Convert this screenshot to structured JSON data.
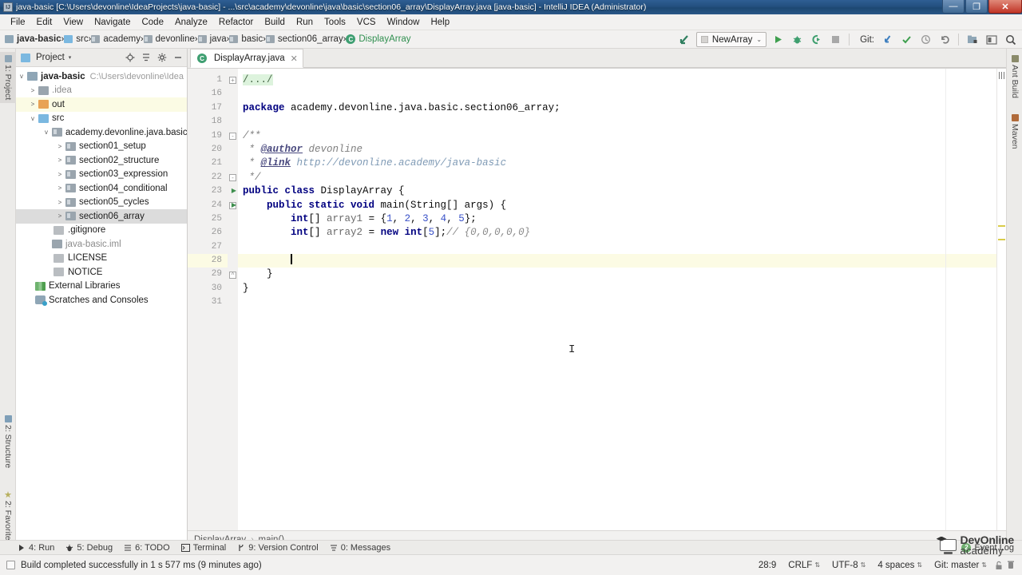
{
  "window": {
    "title": "java-basic [C:\\Users\\devonline\\IdeaProjects\\java-basic] - ...\\src\\academy\\devonline\\java\\basic\\section06_array\\DisplayArray.java [java-basic] - IntelliJ IDEA (Administrator)",
    "icon": "intellij-idea-icon",
    "minimize": "—",
    "maximize": "❐",
    "close": "✕"
  },
  "menubar": {
    "items": [
      {
        "label": "File"
      },
      {
        "label": "Edit"
      },
      {
        "label": "View"
      },
      {
        "label": "Navigate"
      },
      {
        "label": "Code"
      },
      {
        "label": "Analyze"
      },
      {
        "label": "Refactor"
      },
      {
        "label": "Build"
      },
      {
        "label": "Run"
      },
      {
        "label": "Tools"
      },
      {
        "label": "VCS"
      },
      {
        "label": "Window"
      },
      {
        "label": "Help"
      }
    ]
  },
  "navbar": {
    "breadcrumbs": [
      {
        "label": "java-basic",
        "icon": "project-icon"
      },
      {
        "label": "src",
        "icon": "source-folder-icon"
      },
      {
        "label": "academy",
        "icon": "package-icon"
      },
      {
        "label": "devonline",
        "icon": "package-icon"
      },
      {
        "label": "java",
        "icon": "package-icon"
      },
      {
        "label": "basic",
        "icon": "package-icon"
      },
      {
        "label": "section06_array",
        "icon": "package-icon"
      },
      {
        "label": "DisplayArray",
        "icon": "java-class-icon"
      }
    ],
    "separator": "›",
    "run_config": {
      "name": "NewArray",
      "chevron": "⌄"
    },
    "git_label": "Git:",
    "tool_icons": [
      "back-arrow-icon",
      "run-icon",
      "debug-icon",
      "run-with-coverage-icon",
      "stop-icon",
      "git-update-icon",
      "git-commit-icon",
      "history-icon",
      "revert-icon",
      "settings-project-icon",
      "restore-layout-icon",
      "search-everywhere-icon"
    ]
  },
  "left_strip": {
    "tabs": [
      {
        "label": "1: Project",
        "icon": "project-tool-icon",
        "selected": true
      },
      {
        "label": "2: Structure",
        "icon": "structure-tool-icon",
        "selected": false
      },
      {
        "label": "2: Favorites",
        "icon": "favorites-star-icon",
        "selected": false
      }
    ]
  },
  "right_strip": {
    "tabs": [
      {
        "label": "Ant Build",
        "icon": "ant-build-icon"
      },
      {
        "label": "Maven",
        "icon": "maven-icon"
      }
    ]
  },
  "project_panel": {
    "title": "Project",
    "chevron": "▾",
    "header_icons": [
      "locate-icon",
      "collapse-all-icon",
      "settings-gear-icon",
      "hide-icon"
    ],
    "tree": [
      {
        "label": "java-basic",
        "path": "C:\\Users\\devonline\\IdeaProjects",
        "indent": 0,
        "twisty": "v",
        "icon": "project-icon",
        "bold": true,
        "state": "normal"
      },
      {
        "label": ".idea",
        "indent": 1,
        "twisty": ">",
        "icon": "folder-gray-icon",
        "dim": true,
        "state": "normal"
      },
      {
        "label": "out",
        "indent": 1,
        "twisty": ">",
        "icon": "folder-orange-icon",
        "state": "highlight"
      },
      {
        "label": "src",
        "indent": 1,
        "twisty": "v",
        "icon": "folder-blue-icon",
        "state": "normal"
      },
      {
        "label": "academy.devonline.java.basic",
        "indent": 2,
        "twisty": "v",
        "icon": "package-icon",
        "state": "normal"
      },
      {
        "label": "section01_setup",
        "indent": 3,
        "twisty": ">",
        "icon": "package-icon",
        "state": "normal"
      },
      {
        "label": "section02_structure",
        "indent": 3,
        "twisty": ">",
        "icon": "package-icon",
        "state": "normal"
      },
      {
        "label": "section03_expression",
        "indent": 3,
        "twisty": ">",
        "icon": "package-icon",
        "state": "normal"
      },
      {
        "label": "section04_conditional",
        "indent": 3,
        "twisty": ">",
        "icon": "package-icon",
        "state": "normal"
      },
      {
        "label": "section05_cycles",
        "indent": 3,
        "twisty": ">",
        "icon": "package-icon",
        "state": "normal"
      },
      {
        "label": "section06_array",
        "indent": 3,
        "twisty": ">",
        "icon": "package-icon",
        "state": "selected"
      },
      {
        "label": ".gitignore",
        "indent": 2,
        "twisty": "",
        "icon": "file-icon",
        "state": "normal"
      },
      {
        "label": "java-basic.iml",
        "indent": 2,
        "twisty": "",
        "icon": "iml-file-icon",
        "dim": true,
        "state": "normal"
      },
      {
        "label": "LICENSE",
        "indent": 2,
        "twisty": "",
        "icon": "file-icon",
        "state": "normal"
      },
      {
        "label": "NOTICE",
        "indent": 2,
        "twisty": "",
        "icon": "file-icon",
        "state": "normal"
      },
      {
        "label": "External Libraries",
        "indent": 0,
        "twisty": "",
        "icon": "library-icon",
        "state": "normal"
      },
      {
        "label": "Scratches and Consoles",
        "indent": 0,
        "twisty": "",
        "icon": "scratches-icon",
        "state": "normal"
      }
    ]
  },
  "editor": {
    "tab": {
      "label": "DisplayArray.java",
      "icon": "java-class-icon",
      "close": "✕"
    },
    "lines": [
      {
        "num": "1",
        "fold": "+",
        "gmark": "",
        "current": false,
        "tokens": [
          {
            "t": "/.../",
            "c": "fold"
          }
        ]
      },
      {
        "num": "16",
        "fold": "",
        "gmark": "",
        "current": false,
        "tokens": []
      },
      {
        "num": "17",
        "fold": "",
        "gmark": "",
        "current": false,
        "tokens": [
          {
            "t": "package",
            "c": "kw"
          },
          {
            "t": " academy.devonline.java.basic.section06_array;",
            "c": "plain"
          }
        ]
      },
      {
        "num": "18",
        "fold": "",
        "gmark": "",
        "current": false,
        "tokens": []
      },
      {
        "num": "19",
        "fold": "-",
        "gmark": "",
        "current": false,
        "tokens": [
          {
            "t": "/**",
            "c": "jdoc"
          }
        ]
      },
      {
        "num": "20",
        "fold": "",
        "gmark": "",
        "current": false,
        "tokens": [
          {
            "t": " * ",
            "c": "jdoc"
          },
          {
            "t": "@author",
            "c": "jtag"
          },
          {
            "t": " devonline",
            "c": "jdoc"
          }
        ]
      },
      {
        "num": "21",
        "fold": "",
        "gmark": "",
        "current": false,
        "tokens": [
          {
            "t": " * ",
            "c": "jdoc"
          },
          {
            "t": "@link",
            "c": "jtag"
          },
          {
            "t": " http://devonline.academy/java-basic",
            "c": "link"
          }
        ]
      },
      {
        "num": "22",
        "fold": "-",
        "gmark": "",
        "current": false,
        "tokens": [
          {
            "t": " */",
            "c": "jdoc"
          }
        ]
      },
      {
        "num": "23",
        "fold": "",
        "gmark": "▶",
        "current": false,
        "tokens": [
          {
            "t": "public class",
            "c": "kw"
          },
          {
            "t": " DisplayArray {",
            "c": "plain"
          }
        ]
      },
      {
        "num": "24",
        "fold": "-",
        "gmark": "▶",
        "current": false,
        "tokens": [
          {
            "t": "    ",
            "c": "plain"
          },
          {
            "t": "public static void",
            "c": "kw"
          },
          {
            "t": " main(String[] args) {",
            "c": "plain"
          }
        ]
      },
      {
        "num": "25",
        "fold": "",
        "gmark": "",
        "current": false,
        "tokens": [
          {
            "t": "        ",
            "c": "plain"
          },
          {
            "t": "int",
            "c": "kw"
          },
          {
            "t": "[] ",
            "c": "plain"
          },
          {
            "t": "array1",
            "c": "ident"
          },
          {
            "t": " = {",
            "c": "plain"
          },
          {
            "t": "1",
            "c": "num"
          },
          {
            "t": ", ",
            "c": "plain"
          },
          {
            "t": "2",
            "c": "num"
          },
          {
            "t": ", ",
            "c": "plain"
          },
          {
            "t": "3",
            "c": "num"
          },
          {
            "t": ", ",
            "c": "plain"
          },
          {
            "t": "4",
            "c": "num"
          },
          {
            "t": ", ",
            "c": "plain"
          },
          {
            "t": "5",
            "c": "num"
          },
          {
            "t": "};",
            "c": "plain"
          }
        ]
      },
      {
        "num": "26",
        "fold": "",
        "gmark": "",
        "current": false,
        "tokens": [
          {
            "t": "        ",
            "c": "plain"
          },
          {
            "t": "int",
            "c": "kw"
          },
          {
            "t": "[] ",
            "c": "plain"
          },
          {
            "t": "array2",
            "c": "ident"
          },
          {
            "t": " = ",
            "c": "plain"
          },
          {
            "t": "new int",
            "c": "kw"
          },
          {
            "t": "[",
            "c": "plain"
          },
          {
            "t": "5",
            "c": "num"
          },
          {
            "t": "];",
            "c": "plain"
          },
          {
            "t": "// {0,0,0,0,0}",
            "c": "cmt"
          }
        ]
      },
      {
        "num": "27",
        "fold": "",
        "gmark": "",
        "current": false,
        "tokens": []
      },
      {
        "num": "28",
        "fold": "",
        "gmark": "",
        "current": true,
        "tokens": [
          {
            "t": "        ",
            "c": "plain"
          },
          {
            "t": "",
            "c": "caret"
          }
        ]
      },
      {
        "num": "29",
        "fold": "^",
        "gmark": "",
        "current": false,
        "tokens": [
          {
            "t": "    }",
            "c": "plain"
          }
        ]
      },
      {
        "num": "30",
        "fold": "",
        "gmark": "",
        "current": false,
        "tokens": [
          {
            "t": "}",
            "c": "plain"
          }
        ]
      },
      {
        "num": "31",
        "fold": "",
        "gmark": "",
        "current": false,
        "tokens": []
      }
    ],
    "breadcrumb": {
      "items": [
        "DisplayArray",
        "main()"
      ],
      "separator": "›"
    },
    "markers": [
      "warning-marker",
      "warning-marker"
    ]
  },
  "logo": {
    "line1": "DevOnline",
    "line2": "academy",
    "icon": "devonline-academy-logo"
  },
  "tool_window_bar": {
    "items": [
      {
        "label": "4: Run",
        "key": "4",
        "icon": "run-icon"
      },
      {
        "label": "5: Debug",
        "key": "5",
        "icon": "debug-icon"
      },
      {
        "label": "6: TODO",
        "key": "6",
        "icon": "todo-icon"
      },
      {
        "label": "Terminal",
        "key": "",
        "icon": "terminal-icon"
      },
      {
        "label": "9: Version Control",
        "key": "9",
        "icon": "version-control-icon"
      },
      {
        "label": "0: Messages",
        "key": "0",
        "icon": "messages-icon"
      }
    ],
    "event_log": {
      "label": "Event Log",
      "count": "2"
    }
  },
  "statusbar": {
    "message": "Build completed successfully in 1 s 577 ms (9 minutes ago)",
    "caret_position": "28:9",
    "line_separator": "CRLF",
    "encoding": "UTF-8",
    "indent": "4 spaces",
    "branch": "Git: master",
    "lock_icon": "unlocked-icon",
    "memory_icon": "trash-icon",
    "updown": "⇅"
  },
  "colors": {
    "accent_blue": "#2f5e93",
    "keyword": "#000080",
    "number": "#3a52c8",
    "comment": "#8a8a8a",
    "current_line": "#fcfbe4",
    "folder_orange": "#e8a355",
    "folder_blue": "#7bb8e0",
    "green_class": "#2f8f4f",
    "warning_marker": "#d9cc4a"
  }
}
